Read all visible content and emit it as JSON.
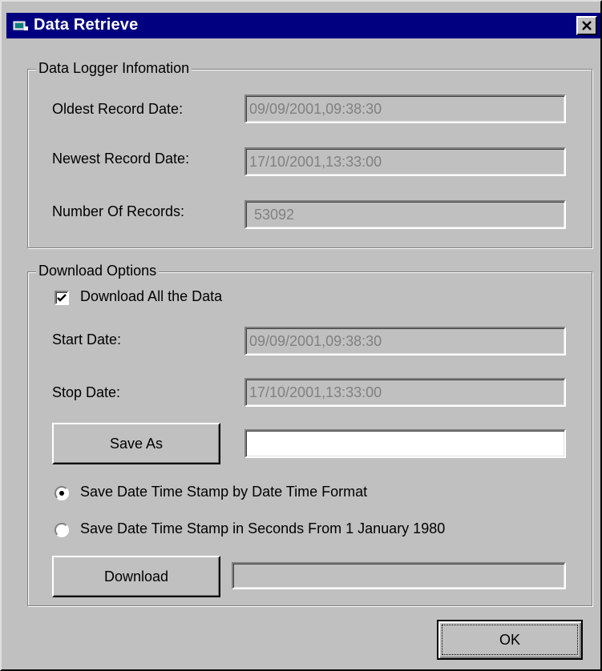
{
  "window": {
    "title": "Data Retrieve",
    "icon": "app-icon",
    "close_glyph": "✕"
  },
  "logger_info": {
    "legend": "Data Logger Infomation",
    "oldest_label": "Oldest Record Date:",
    "oldest_value": "09/09/2001,09:38:30",
    "newest_label": "Newest Record Date:",
    "newest_value": "17/10/2001,13:33:00",
    "count_label": "Number Of Records:",
    "count_value": "53092"
  },
  "download_options": {
    "legend": "Download Options",
    "download_all_label": "Download All the Data",
    "download_all_checked": true,
    "start_label": "Start Date:",
    "start_value": "09/09/2001,09:38:30",
    "stop_label": "Stop Date:",
    "stop_value": "17/10/2001,13:33:00",
    "save_as_label": "Save As",
    "save_as_path": "",
    "radio_datetime_label": "Save Date Time Stamp by Date Time Format",
    "radio_datetime_selected": true,
    "radio_seconds_label": "Save Date Time Stamp in Seconds From 1 January 1980",
    "radio_seconds_selected": false,
    "download_label": "Download",
    "download_progress": 0
  },
  "ok_label": "OK"
}
